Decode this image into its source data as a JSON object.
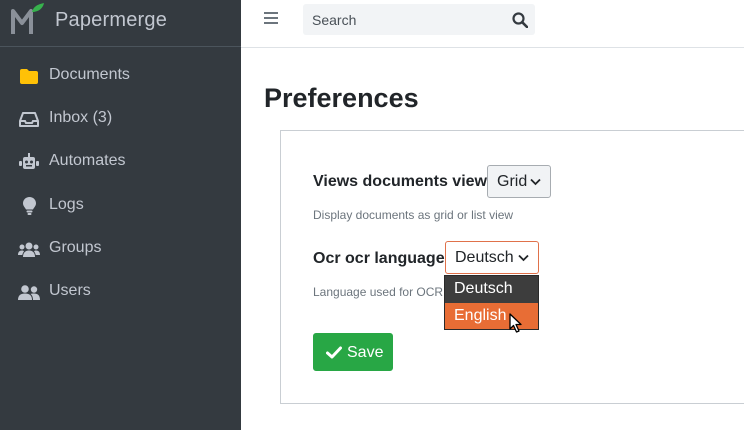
{
  "brand": {
    "name": "Papermerge"
  },
  "sidebar": {
    "items": [
      {
        "label": "Documents",
        "icon": "folder-icon"
      },
      {
        "label": "Inbox (3)",
        "icon": "inbox-icon"
      },
      {
        "label": "Automates",
        "icon": "robot-icon"
      },
      {
        "label": "Logs",
        "icon": "lightbulb-icon"
      },
      {
        "label": "Groups",
        "icon": "users-group-icon"
      },
      {
        "label": "Users",
        "icon": "users-icon"
      }
    ]
  },
  "topbar": {
    "search": {
      "placeholder": "Search"
    }
  },
  "page": {
    "title": "Preferences",
    "fields": {
      "view": {
        "label": "Views documents view:",
        "value": "Grid",
        "help": "Display documents as grid or list view"
      },
      "ocr": {
        "label": "Ocr ocr language:",
        "value": "Deutsch",
        "help": "Language used for OCR",
        "options": [
          "Deutsch",
          "English"
        ],
        "highlighted": "English"
      }
    },
    "save_label": "Save"
  },
  "colors": {
    "sidebar_bg": "#343a40",
    "accent_save": "#28a745",
    "dropdown_highlight": "#e86d35",
    "folder": "#ffc107"
  }
}
